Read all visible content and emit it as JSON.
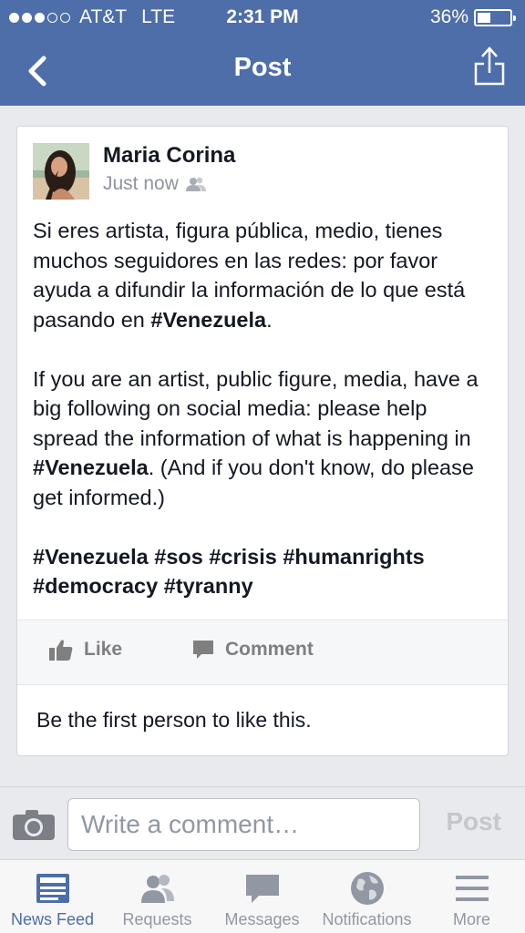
{
  "status_bar": {
    "carrier": "AT&T",
    "network": "LTE",
    "time": "2:31 PM",
    "battery": "36%",
    "battery_level": 0.36,
    "signal_bars_filled": 3,
    "signal_bars_total": 5
  },
  "nav": {
    "title": "Post",
    "back_icon": "chevron-left-icon",
    "share_icon": "share-icon"
  },
  "post": {
    "author": "Maria Corina",
    "timestamp": "Just now",
    "privacy_icon": "friends-icon",
    "para1_text": "Si eres artista, figura pública, medio, tienes muchos seguidores en las redes: por favor ayuda a difundir la información de lo que está pasando en ",
    "para1_tag": "#Venezuela",
    "para1_end": ".",
    "para2_text": "If you are an artist, public figure, media, have a big following on social media: please help spread the information of what is happening in ",
    "para2_tag": "#Venezuela",
    "para2_end": ". (And if you don't know, do please get informed.)",
    "hashtags_line1": "#Venezuela #sos #crisis #humanrights",
    "hashtags_line2": "#democracy #tyranny",
    "like_label": "Like",
    "comment_label": "Comment",
    "likes_summary": "Be the first person to like this."
  },
  "comment_bar": {
    "placeholder": "Write a comment…",
    "post_label": "Post",
    "camera_icon": "camera-icon"
  },
  "tabs": [
    {
      "label": "News Feed",
      "icon": "news-feed-icon",
      "active": true
    },
    {
      "label": "Requests",
      "icon": "friend-requests-icon",
      "active": false
    },
    {
      "label": "Messages",
      "icon": "messages-icon",
      "active": false
    },
    {
      "label": "Notifications",
      "icon": "globe-icon",
      "active": false
    },
    {
      "label": "More",
      "icon": "menu-icon",
      "active": false
    }
  ],
  "colors": {
    "brand_blue": "#4d6ea9",
    "background": "#e9eaed",
    "inactive_gray": "#9197a3"
  }
}
